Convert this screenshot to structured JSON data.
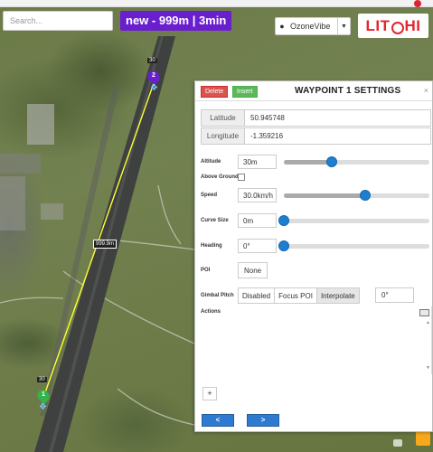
{
  "search": {
    "placeholder": "Search..."
  },
  "mission_banner": "new - 999m | 3min",
  "user": {
    "name": "OzoneVibe"
  },
  "logo": {
    "part1": "LIT",
    "part2": "HI"
  },
  "map": {
    "distance_label": "999.9m",
    "waypoints": [
      {
        "number": "2",
        "altitude": "30",
        "color": "#6a1fcf"
      },
      {
        "number": "1",
        "altitude": "30",
        "color": "#33b34a"
      }
    ],
    "path_color": "#ffff33"
  },
  "panel": {
    "delete_label": "Delete",
    "insert_label": "Insert",
    "title": "WAYPOINT 1 SETTINGS",
    "close": "×",
    "latitude_label": "Latitude",
    "latitude": "50.945748",
    "longitude_label": "Longitude",
    "longitude": "-1.359216",
    "altitude_label": "Altitude",
    "altitude": "30m",
    "altitude_fraction": 0.33,
    "above_ground_label": "Above Ground",
    "speed_label": "Speed",
    "speed": "30.0km/h",
    "speed_fraction": 0.56,
    "curve_label": "Curve Size",
    "curve": "0m",
    "curve_fraction": 0,
    "heading_label": "Heading",
    "heading": "0°",
    "heading_fraction": 0,
    "poi_label": "POI",
    "poi_value": "None",
    "gimbal_label": "Gimbal Pitch",
    "gimbal_options": [
      "Disabled",
      "Focus POI",
      "Interpolate"
    ],
    "gimbal_active": "Interpolate",
    "gimbal_value": "0°",
    "actions_label": "Actions",
    "add_label": "+",
    "prev_label": "<",
    "next_label": ">"
  }
}
